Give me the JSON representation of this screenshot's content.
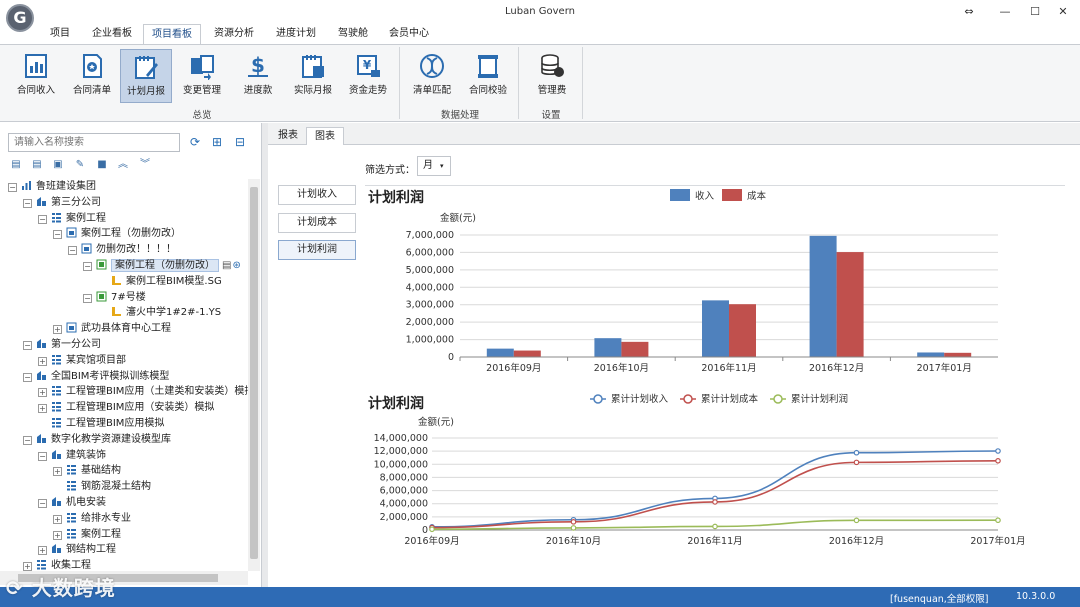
{
  "app": {
    "title": "Luban Govern",
    "logo_letter": "G"
  },
  "window_buttons": {
    "restore": "⇔",
    "minimize": "—",
    "maximize": "☐",
    "close": "✕"
  },
  "menu": [
    "项目",
    "企业看板",
    "项目看板",
    "资源分析",
    "进度计划",
    "驾驶舱",
    "会员中心"
  ],
  "menu_active": 2,
  "ribbon": {
    "groups": [
      {
        "label": "总览",
        "buttons": [
          "合同收入",
          "合同清单",
          "计划月报",
          "变更管理",
          "进度款",
          "实际月报",
          "资金走势"
        ]
      },
      {
        "label": "数据处理",
        "buttons": [
          "清单匹配",
          "合同校验"
        ]
      },
      {
        "label": "设置",
        "buttons": [
          "管理费"
        ]
      }
    ],
    "active_button": "计划月报"
  },
  "left": {
    "search_placeholder": "请输入名称搜索",
    "tree": [
      {
        "label": "鲁班建设集团",
        "level": 0,
        "toggle": "−",
        "icon": "bar"
      },
      {
        "label": "第三分公司",
        "level": 1,
        "toggle": "−",
        "icon": "org"
      },
      {
        "label": "案例工程",
        "level": 2,
        "toggle": "−",
        "icon": "list"
      },
      {
        "label": "案例工程（勿删勿改）",
        "level": 3,
        "toggle": "−",
        "icon": "proj"
      },
      {
        "label": "勿删勿改！！！！",
        "level": 4,
        "toggle": "−",
        "icon": "proj"
      },
      {
        "label": "案例工程（勿删勿改）",
        "level": 5,
        "toggle": "−",
        "icon": "green",
        "selected": true
      },
      {
        "label": "案例工程BIM模型.SG",
        "level": 6,
        "toggle": "",
        "icon": "file"
      },
      {
        "label": "7#号楼",
        "level": 5,
        "toggle": "−",
        "icon": "green"
      },
      {
        "label": "瀋火中学1#2#-1.YS",
        "level": 6,
        "toggle": "",
        "icon": "file"
      },
      {
        "label": "武功县体育中心工程",
        "level": 3,
        "toggle": "+",
        "icon": "proj"
      },
      {
        "label": "第一分公司",
        "level": 1,
        "toggle": "−",
        "icon": "org"
      },
      {
        "label": "某宾馆项目部",
        "level": 2,
        "toggle": "+",
        "icon": "list"
      },
      {
        "label": "全国BIM考评模拟训练模型",
        "level": 1,
        "toggle": "−",
        "icon": "org"
      },
      {
        "label": "工程管理BIM应用（土建类和安装类）模拟",
        "level": 2,
        "toggle": "+",
        "icon": "list"
      },
      {
        "label": "工程管理BIM应用（安装类）模拟",
        "level": 2,
        "toggle": "+",
        "icon": "list"
      },
      {
        "label": "工程管理BIM应用模拟",
        "level": 2,
        "toggle": "",
        "icon": "list"
      },
      {
        "label": "数字化教学资源建设模型库",
        "level": 1,
        "toggle": "−",
        "icon": "org"
      },
      {
        "label": "建筑装饰",
        "level": 2,
        "toggle": "−",
        "icon": "org"
      },
      {
        "label": "基础结构",
        "level": 3,
        "toggle": "+",
        "icon": "list"
      },
      {
        "label": "钢筋混凝土结构",
        "level": 3,
        "toggle": "",
        "icon": "list"
      },
      {
        "label": "机电安装",
        "level": 2,
        "toggle": "−",
        "icon": "org"
      },
      {
        "label": "给排水专业",
        "level": 3,
        "toggle": "+",
        "icon": "list"
      },
      {
        "label": "案例工程",
        "level": 3,
        "toggle": "+",
        "icon": "list"
      },
      {
        "label": "钢结构工程",
        "level": 2,
        "toggle": "+",
        "icon": "org"
      },
      {
        "label": "收集工程",
        "level": 1,
        "toggle": "+",
        "icon": "list"
      }
    ]
  },
  "content": {
    "tabs": [
      "报表",
      "图表"
    ],
    "active_tab": 1,
    "filter": {
      "label": "筛选方式：",
      "value": "月"
    },
    "side_buttons": [
      "计划收入",
      "计划成本",
      "计划利润"
    ],
    "active_side": 2
  },
  "chart_data": [
    {
      "type": "bar",
      "title": "计划利润",
      "ylabel": "金额(元)",
      "categories": [
        "2016年09月",
        "2016年10月",
        "2016年11月",
        "2016年12月",
        "2017年01月"
      ],
      "series": [
        {
          "name": "收入",
          "color": "#4f81bd",
          "values": [
            480000,
            1080000,
            3250000,
            6950000,
            260000
          ]
        },
        {
          "name": "成本",
          "color": "#c0504d",
          "values": [
            370000,
            870000,
            3030000,
            6020000,
            240000
          ]
        }
      ],
      "ylim": [
        0,
        7000000
      ],
      "yticks": [
        "0",
        "1,000,000",
        "2,000,000",
        "3,000,000",
        "4,000,000",
        "5,000,000",
        "6,000,000",
        "7,000,000"
      ],
      "legend": "top-center"
    },
    {
      "type": "line",
      "title": "计划利润",
      "ylabel": "金额(元)",
      "categories": [
        "2016年09月",
        "2016年10月",
        "2016年11月",
        "2016年12月",
        "2017年01月"
      ],
      "series": [
        {
          "name": "累计计划收入",
          "color": "#4f81bd",
          "values": [
            480000,
            1560000,
            4810000,
            11760000,
            12020000
          ]
        },
        {
          "name": "累计计划成本",
          "color": "#c0504d",
          "values": [
            370000,
            1240000,
            4270000,
            10290000,
            10530000
          ]
        },
        {
          "name": "累计计划利润",
          "color": "#9bbb59",
          "values": [
            110000,
            320000,
            540000,
            1470000,
            1490000
          ]
        }
      ],
      "ylim": [
        0,
        14000000
      ],
      "yticks": [
        "0",
        "2,000,000",
        "4,000,000",
        "6,000,000",
        "8,000,000",
        "10,000,000",
        "12,000,000",
        "14,000,000"
      ],
      "legend": "top-center"
    }
  ],
  "status": {
    "user": "[fusenquan,全部权限]",
    "version": "10.3.0.0"
  },
  "watermark": "大数跨境"
}
